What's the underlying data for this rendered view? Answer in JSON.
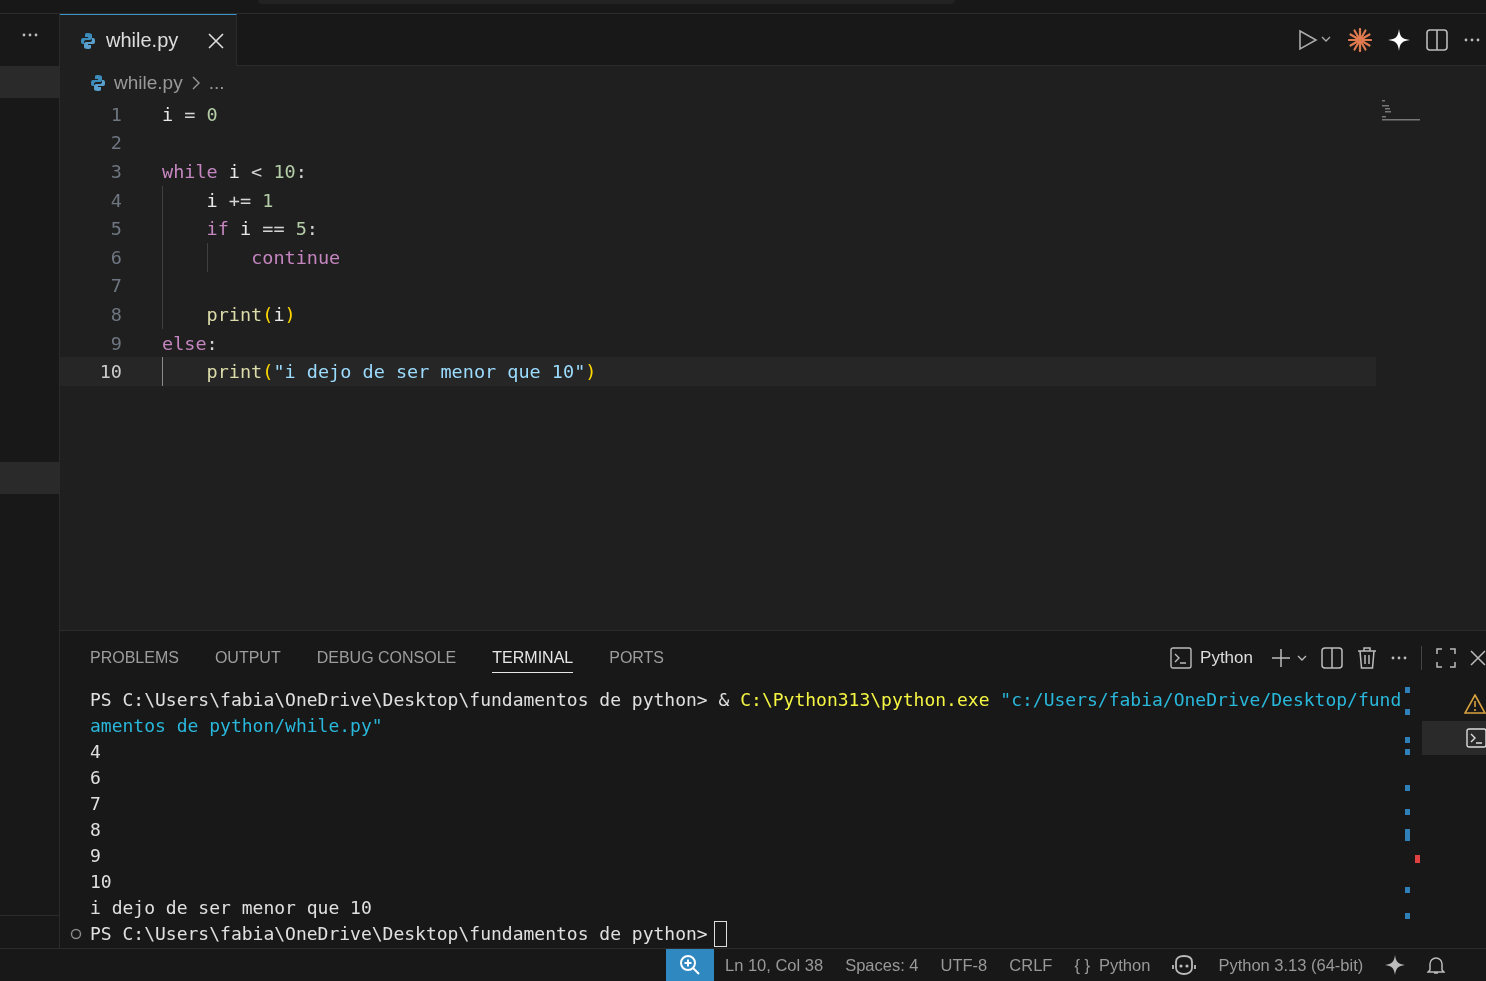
{
  "editor_tabs": [
    {
      "label": "while.py",
      "selected": true
    }
  ],
  "breadcrumb": {
    "file": "while.py",
    "rest": "..."
  },
  "editor": {
    "lines": [
      {
        "number": "1",
        "current": false,
        "tokens": [
          {
            "kind": "var",
            "text": "i"
          },
          {
            "kind": "plain",
            "text": " = "
          },
          {
            "kind": "number",
            "text": "0"
          }
        ]
      },
      {
        "number": "2",
        "current": false
      },
      {
        "number": "3",
        "current": false,
        "tokens": [
          {
            "kind": "keyword",
            "text": "while"
          },
          {
            "kind": "var",
            "text": " i"
          },
          {
            "kind": "plain",
            "text": " < "
          },
          {
            "kind": "number",
            "text": "10"
          },
          {
            "kind": "plain",
            "text": ":"
          }
        ]
      },
      {
        "number": "4",
        "current": false,
        "tokens": [
          {
            "kind": "var",
            "text": "    i"
          },
          {
            "kind": "plain",
            "text": " += "
          },
          {
            "kind": "number",
            "text": "1"
          }
        ]
      },
      {
        "number": "5",
        "current": false,
        "tokens": [
          {
            "kind": "keyword",
            "text": "    if"
          },
          {
            "kind": "var",
            "text": " i"
          },
          {
            "kind": "plain",
            "text": " == "
          },
          {
            "kind": "number",
            "text": "5"
          },
          {
            "kind": "plain",
            "text": ":"
          }
        ]
      },
      {
        "number": "6",
        "current": false,
        "tokens": [
          {
            "kind": "keyword",
            "text": "        continue"
          }
        ]
      },
      {
        "number": "7",
        "current": false
      },
      {
        "number": "8",
        "current": false,
        "tokens": [
          {
            "kind": "function",
            "text": "    print"
          },
          {
            "kind": "bracket",
            "text": "("
          },
          {
            "kind": "var",
            "text": "i"
          },
          {
            "kind": "bracket",
            "text": ")"
          }
        ]
      },
      {
        "number": "9",
        "current": false,
        "tokens": [
          {
            "kind": "keyword",
            "text": "else"
          },
          {
            "kind": "plain",
            "text": ":"
          }
        ]
      },
      {
        "number": "10",
        "current": true,
        "tokens": [
          {
            "kind": "function",
            "text": "    print"
          },
          {
            "kind": "bracket",
            "text": "("
          },
          {
            "kind": "string",
            "text": "\"i dejo de ser menor que 10\""
          },
          {
            "kind": "bracket",
            "text": ")"
          }
        ]
      }
    ]
  },
  "panel": {
    "tabs": [
      {
        "label": "PROBLEMS",
        "selected": false
      },
      {
        "label": "OUTPUT",
        "selected": false
      },
      {
        "label": "DEBUG CONSOLE",
        "selected": false
      },
      {
        "label": "TERMINAL",
        "selected": true
      },
      {
        "label": "PORTS",
        "selected": false
      }
    ],
    "terminal_profile": "Python",
    "terminal_lines": [
      {
        "kind": "output",
        "segments": [
          {
            "kind": "plain",
            "text": "PS C:\\Users\\fabia\\OneDrive\\Desktop\\fundamentos de python> & "
          },
          {
            "kind": "command",
            "text": "C:\\Python313\\python.exe"
          },
          {
            "kind": "string",
            "text": " \"c:/Users/fabia/OneDrive/Desktop/fund"
          }
        ]
      },
      {
        "kind": "output",
        "segments": [
          {
            "kind": "string",
            "text": "amentos de python/while.py\""
          }
        ]
      },
      {
        "kind": "output",
        "segments": [
          {
            "kind": "plain",
            "text": "4"
          }
        ]
      },
      {
        "kind": "output",
        "segments": [
          {
            "kind": "plain",
            "text": "6"
          }
        ]
      },
      {
        "kind": "output",
        "segments": [
          {
            "kind": "plain",
            "text": "7"
          }
        ]
      },
      {
        "kind": "output",
        "segments": [
          {
            "kind": "plain",
            "text": "8"
          }
        ]
      },
      {
        "kind": "output",
        "segments": [
          {
            "kind": "plain",
            "text": "9"
          }
        ]
      },
      {
        "kind": "output",
        "segments": [
          {
            "kind": "plain",
            "text": "10"
          }
        ]
      },
      {
        "kind": "output",
        "segments": [
          {
            "kind": "plain",
            "text": "i dejo de ser menor que 10"
          }
        ]
      },
      {
        "kind": "prompt",
        "segments": [
          {
            "kind": "plain",
            "text": "PS C:\\Users\\fabia\\OneDrive\\Desktop\\fundamentos de python>"
          }
        ]
      }
    ]
  },
  "status_bar": {
    "items": [
      {
        "kind": "zoom"
      },
      {
        "kind": "text",
        "text": "Ln 10, Col 38"
      },
      {
        "kind": "text",
        "text": "Spaces: 4"
      },
      {
        "kind": "text",
        "text": "UTF-8"
      },
      {
        "kind": "text",
        "text": "CRLF"
      },
      {
        "kind": "language",
        "text": "Python",
        "icon": "{ }"
      },
      {
        "kind": "copilot"
      },
      {
        "kind": "text",
        "text": "Python 3.13 (64-bit)"
      },
      {
        "kind": "sparkle"
      },
      {
        "kind": "bell"
      }
    ]
  }
}
